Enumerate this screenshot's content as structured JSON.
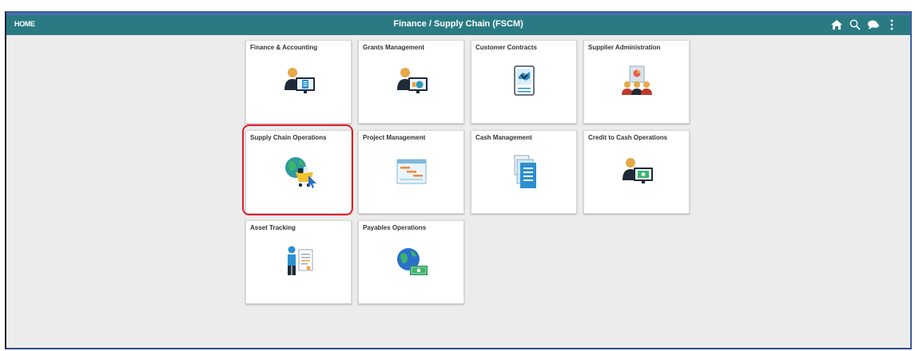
{
  "header": {
    "home_label": "HOME",
    "title": "Finance / Supply Chain (FSCM)",
    "icons": [
      "home-icon",
      "search-icon",
      "chat-icon",
      "menu-dots-icon"
    ]
  },
  "tiles": [
    {
      "label": "Finance & Accounting",
      "icon": "person-monitor-document-icon"
    },
    {
      "label": "Grants Management",
      "icon": "person-monitor-globe-icon"
    },
    {
      "label": "Customer Contracts",
      "icon": "contract-handshake-icon"
    },
    {
      "label": "Supplier Administration",
      "icon": "supplier-group-icon"
    },
    {
      "label": "Supply Chain Operations",
      "icon": "globe-cart-icon"
    },
    {
      "label": "Project Management",
      "icon": "gantt-chart-icon"
    },
    {
      "label": "Cash Management",
      "icon": "document-stack-icon"
    },
    {
      "label": "Credit to Cash Operations",
      "icon": "person-monitor-cash-icon"
    },
    {
      "label": "Asset Tracking",
      "icon": "person-document-icon"
    },
    {
      "label": "Payables Operations",
      "icon": "globe-money-icon"
    }
  ],
  "highlighted_tile": "Supply Chain Operations",
  "colors": {
    "header_bg": "#2a7a83",
    "page_bg": "#ececec",
    "highlight": "#e01f2e"
  }
}
